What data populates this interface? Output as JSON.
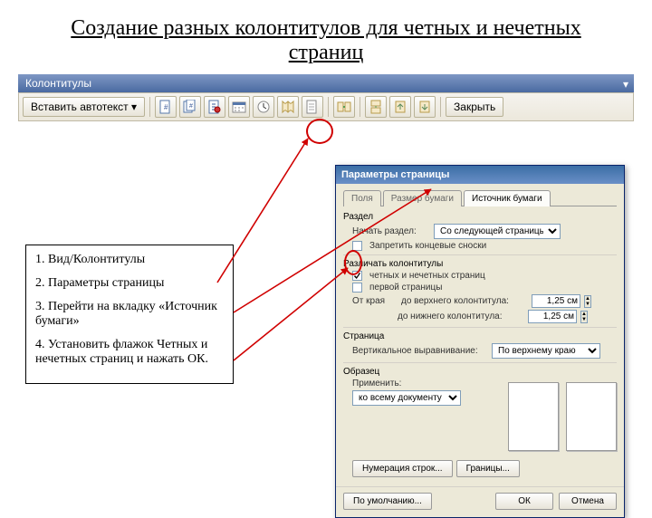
{
  "title": "Создание разных колонтитулов для четных и нечетных страниц",
  "toolbar": {
    "title": "Колонтитулы",
    "autotext": "Вставить автотекст ▾",
    "close": "Закрыть"
  },
  "instructions": {
    "s1": "1. Вид/Колонтитулы",
    "s2": "2. Параметры страницы",
    "s3": "3. Перейти на вкладку «Источник бумаги»",
    "s4": "4. Установить флажок Четных и нечетных страниц и нажать ОК."
  },
  "dialog": {
    "title": "Параметры страницы",
    "tabs": {
      "t1": "Поля",
      "t2": "Размер бумаги",
      "t3": "Источник бумаги"
    },
    "section": {
      "label": "Раздел",
      "start_label": "Начать раздел:",
      "start_value": "Со следующей страницы",
      "suppress": "Запретить концевые сноски"
    },
    "headers": {
      "label": "Различать колонтитулы",
      "odd_even": "четных и нечетных страниц",
      "first": "первой страницы",
      "edge_label": "От края",
      "top_label": "до верхнего колонтитула:",
      "top_value": "1,25 см",
      "bottom_label": "до нижнего колонтитула:",
      "bottom_value": "1,25 см"
    },
    "page": {
      "label": "Страница",
      "valign_label": "Вертикальное выравнивание:",
      "valign_value": "По верхнему краю"
    },
    "preview": {
      "label": "Образец",
      "apply_label": "Применить:",
      "apply_value": "ко всему документу"
    },
    "line_numbers": "Нумерация строк...",
    "borders": "Границы...",
    "default": "По умолчанию...",
    "ok": "ОК",
    "cancel": "Отмена"
  }
}
